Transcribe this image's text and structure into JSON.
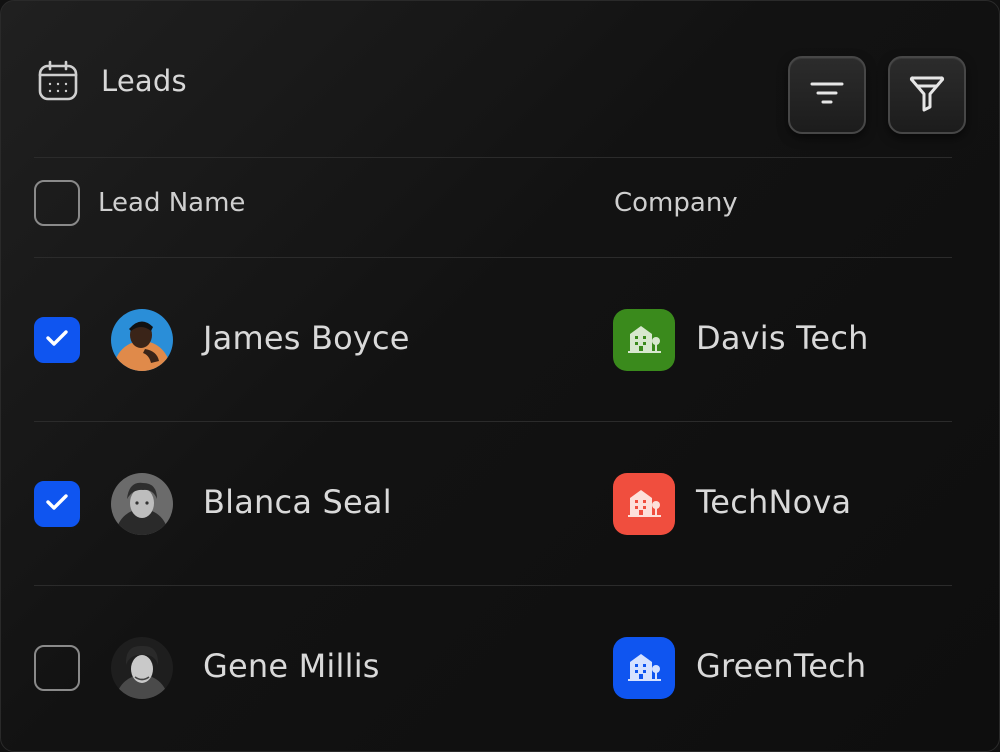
{
  "header": {
    "title": "Leads",
    "icon": "calendar-icon",
    "sort_icon": "sort-lines-icon",
    "filter_icon": "funnel-icon"
  },
  "table": {
    "columns": [
      "Lead Name",
      "Company"
    ],
    "rows": [
      {
        "checked": true,
        "name": "James Boyce",
        "avatar": "avatar-photo",
        "avatar_bg": "#2a8ed8",
        "company": "Davis Tech",
        "company_color": "#3a8a1c",
        "company_icon": "building-icon"
      },
      {
        "checked": true,
        "name": "Blanca Seal",
        "avatar": "avatar-photo",
        "avatar_bg": "#6b6b6b",
        "company": "TechNova",
        "company_color": "#f04e3e",
        "company_icon": "building-icon"
      },
      {
        "checked": false,
        "name": "Gene Millis",
        "avatar": "avatar-photo",
        "avatar_bg": "#3a3a3a",
        "company": "GreenTech",
        "company_color": "#0f55f0",
        "company_icon": "building-icon"
      }
    ]
  },
  "colors": {
    "accent": "#0f55f0",
    "background": "#111111"
  }
}
